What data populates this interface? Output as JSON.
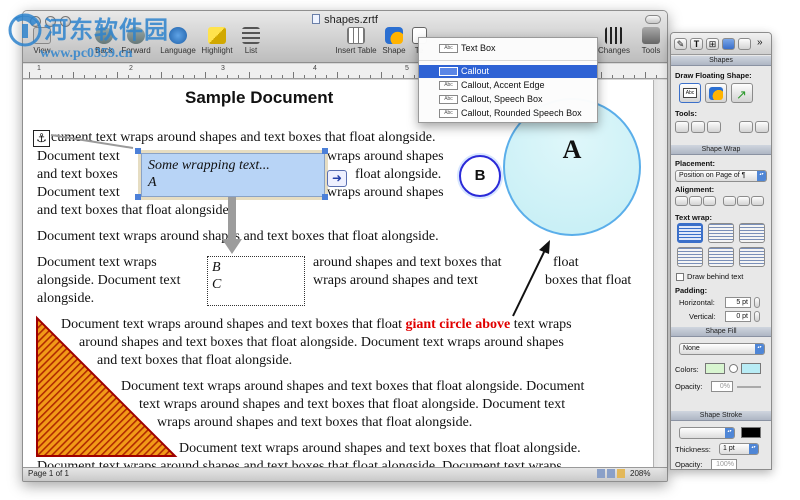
{
  "window": {
    "title": "shapes.zrtf"
  },
  "toolbar": {
    "buttons": [
      {
        "id": "view",
        "label": "View"
      },
      {
        "id": "back",
        "label": "Back"
      },
      {
        "id": "forward",
        "label": "Forward"
      },
      {
        "id": "language",
        "label": "Language"
      },
      {
        "id": "highlight",
        "label": "Highlight"
      },
      {
        "id": "list",
        "label": "List"
      },
      {
        "id": "insert-table",
        "label": "Insert Table"
      },
      {
        "id": "shape",
        "label": "Shape"
      },
      {
        "id": "textbox",
        "label": "Te"
      },
      {
        "id": "changes",
        "label": "Changes"
      },
      {
        "id": "tools",
        "label": "Tools"
      }
    ]
  },
  "ruler": {
    "marks": [
      "1",
      "2",
      "3",
      "4",
      "5",
      "6",
      "7"
    ]
  },
  "dropdown": {
    "items": [
      {
        "label": "Text Box",
        "icon_text": "Abc",
        "selected": false
      },
      {
        "label": "Callout",
        "icon_text": "Abc",
        "selected": true
      },
      {
        "label": "Callout, Accent Edge",
        "icon_text": "Abc",
        "selected": false
      },
      {
        "label": "Callout, Speech Box",
        "icon_text": "Abc",
        "selected": false
      },
      {
        "label": "Callout, Rounded Speech Box",
        "icon_text": "Abc",
        "selected": false
      }
    ]
  },
  "document": {
    "title": "Sample Document",
    "lines": {
      "l1": "cument text wraps around shapes and text boxes that float alongside.",
      "l2a": "Document text",
      "l2b": "wraps around shapes",
      "l3a": "and text boxes",
      "l3b": "float alongside.",
      "l4a": "Document text",
      "l4b": "wraps around shapes",
      "l5": "and text boxes that float alongside.",
      "l6": "Document text wraps around shapes and text boxes that float alongside.",
      "l7a": "Document text wraps",
      "l7b": "around shapes and text boxes that",
      "l7c": "float",
      "l8a": "alongside. Document text",
      "l8b": "wraps around shapes and text",
      "l8c": "boxes that float",
      "l9": "alongside.",
      "l10a": "Document text wraps around shapes and text boxes that float",
      "l10red": "giant circle above",
      "l10b": "text wraps",
      "l11": "around shapes and text boxes that float alongside. Document text wraps around shapes",
      "l12": "and text boxes that float alongside.",
      "l13": "Document text wraps around shapes and text boxes that float alongside. Document",
      "l14": "text wraps around shapes and text boxes that float alongside. Document text",
      "l15": "wraps around shapes and text boxes that float alongside.",
      "l16": "Document text wraps around shapes and text boxes that float alongside.",
      "l17": "Document text wraps around shapes and text boxes that float alongside. Document text wraps"
    },
    "callout": {
      "line1": "Some wrapping text...",
      "line2": "A"
    },
    "textbox_bc": {
      "line1": "B",
      "line2": "C"
    },
    "circle_large_label": "A",
    "circle_small_label": "B"
  },
  "status": {
    "page": "Page 1 of 1",
    "zoom": "208%"
  },
  "inspector": {
    "sections": {
      "shapes": "Shapes",
      "shape_wrap": "Shape Wrap",
      "shape_fill": "Shape Fill",
      "shape_stroke": "Shape Stroke"
    },
    "draw_floating_shape": "Draw Floating Shape:",
    "tools_label": "Tools:",
    "placement_label": "Placement:",
    "placement_value": "Position on Page of ¶",
    "alignment_label": "Alignment:",
    "text_wrap_label": "Text wrap:",
    "draw_behind_text": "Draw behind text",
    "padding_label": "Padding:",
    "horizontal_label": "Horizontal:",
    "horizontal_value": "5 pt",
    "vertical_label": "Vertical:",
    "vertical_value": "0 pt",
    "fill_value": "None",
    "colors_label": "Colors:",
    "opacity_label": "Opacity:",
    "opacity_value": "0%",
    "thickness_label": "Thickness:",
    "thickness_value": "1 pt",
    "opacity2_label": "Opacity:",
    "opacity2_value": "100%"
  },
  "watermark": {
    "title": "河东软件园",
    "url": "www.pc0359.cn"
  },
  "colors": {
    "selection": "#2e62d4",
    "callout_fill": "#b8d4f6",
    "circle_fill": "#c9f1f6",
    "circle_stroke": "#5aaeea",
    "triangle_fill": "#f08a00",
    "triangle_stroke": "#b00000",
    "red_text": "#e00000"
  }
}
